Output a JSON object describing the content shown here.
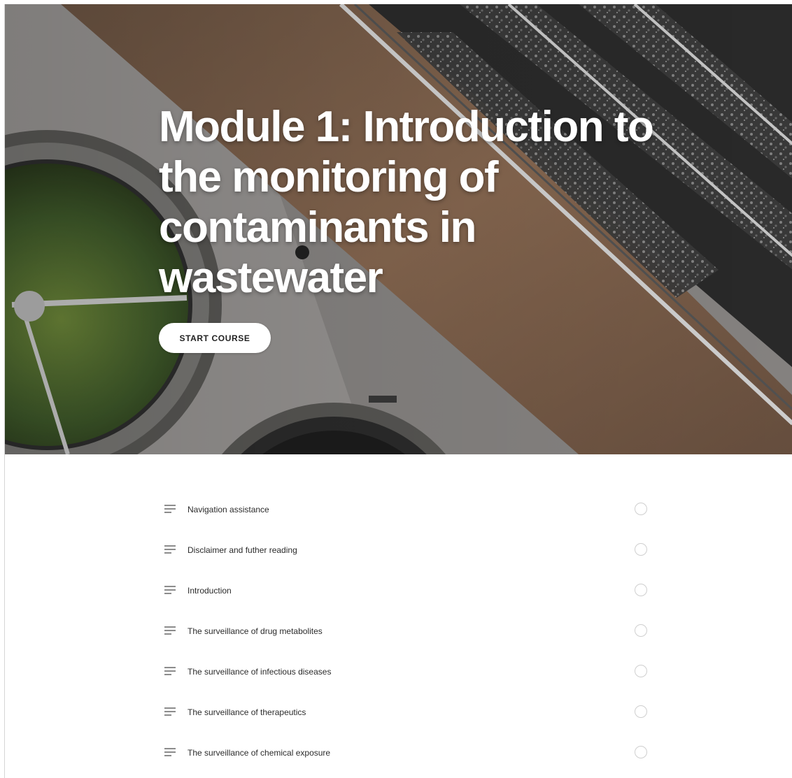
{
  "hero": {
    "title": "Module 1: Introduction to the monitoring of contaminants in wastewater",
    "start_label": "START COURSE"
  },
  "lessons": [
    {
      "title": "Navigation assistance",
      "icon": "text-lines-icon",
      "status": "not-started"
    },
    {
      "title": "Disclaimer and futher reading",
      "icon": "text-lines-icon",
      "status": "not-started"
    },
    {
      "title": "Introduction",
      "icon": "text-lines-icon",
      "status": "not-started"
    },
    {
      "title": "The surveillance of drug metabolites",
      "icon": "text-lines-icon",
      "status": "not-started"
    },
    {
      "title": "The surveillance of infectious diseases",
      "icon": "text-lines-icon",
      "status": "not-started"
    },
    {
      "title": "The surveillance of therapeutics",
      "icon": "text-lines-icon",
      "status": "not-started"
    },
    {
      "title": "The surveillance of chemical exposure",
      "icon": "text-lines-icon",
      "status": "not-started"
    }
  ],
  "colors": {
    "accent_text": "#ffffff",
    "status_ring": "#cfcfcf",
    "lesson_text": "#2b2b2b"
  }
}
